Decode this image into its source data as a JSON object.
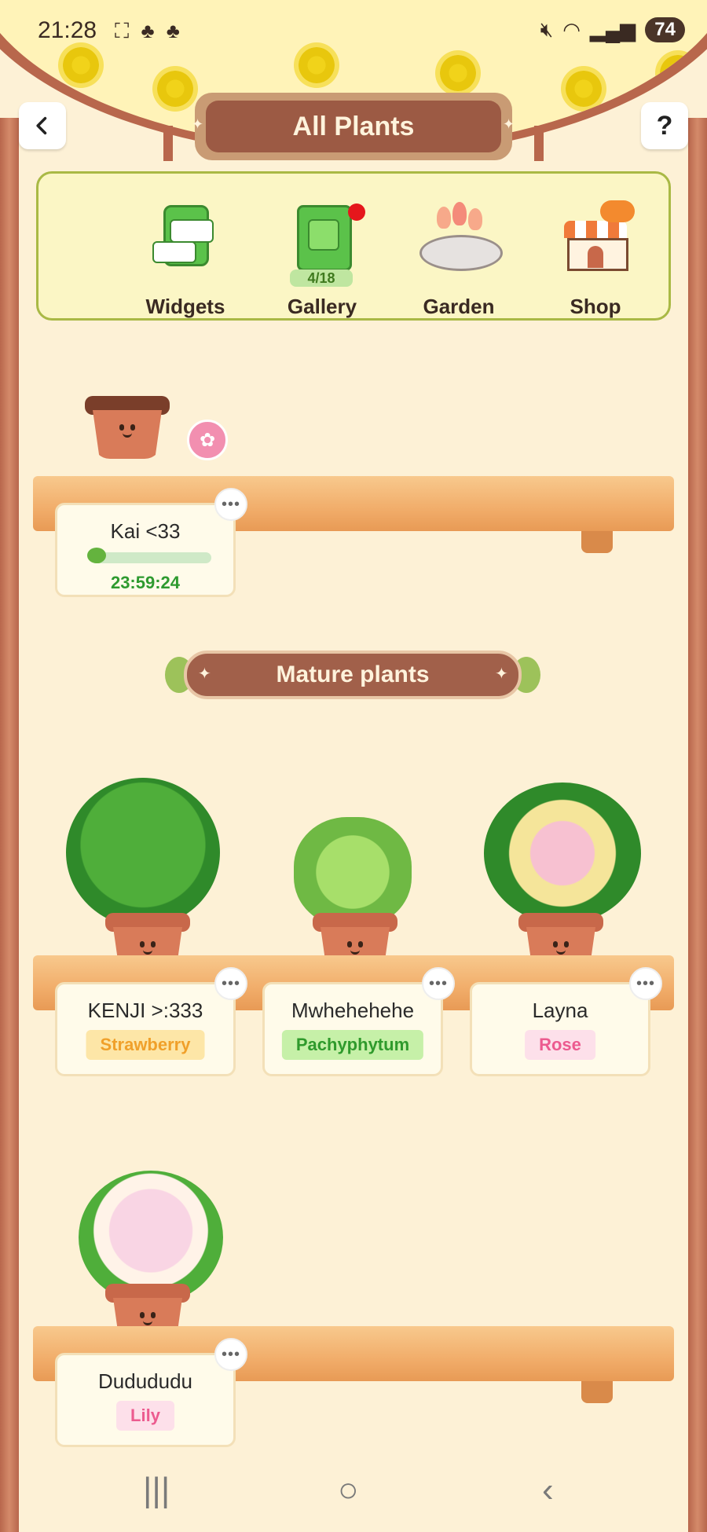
{
  "status_bar": {
    "time": "21:28",
    "battery": "74",
    "left_icons": [
      "screenshot-icon",
      "tree-icon",
      "tree-icon"
    ],
    "right_icons": [
      "mute-icon",
      "wifi-icon",
      "signal-icon"
    ]
  },
  "header": {
    "title": "All Plants",
    "help_label": "?"
  },
  "nav": {
    "items": [
      {
        "label": "Widgets",
        "icon": "widgets-icon"
      },
      {
        "label": "Gallery",
        "icon": "gallery-book-icon",
        "count": "4/18",
        "has_notification": true
      },
      {
        "label": "Garden",
        "icon": "garden-icon"
      },
      {
        "label": "Shop",
        "icon": "shop-icon"
      }
    ]
  },
  "growing": {
    "plants": [
      {
        "name": "Kai <33",
        "timer": "23:59:24",
        "progress_fraction": 0.08
      }
    ]
  },
  "mature": {
    "heading": "Mature plants",
    "plants": [
      {
        "name": "KENJI >:333",
        "species": "Strawberry",
        "tag_bg": "#fde6a7",
        "tag_fg": "#f0a02a"
      },
      {
        "name": "Mwhehehehe",
        "species": "Pachyphytum",
        "tag_bg": "#c6f0a8",
        "tag_fg": "#2f9a2c"
      },
      {
        "name": "Layna",
        "species": "Rose",
        "tag_bg": "#fde0ea",
        "tag_fg": "#ec5b8f"
      },
      {
        "name": "Dudududu",
        "species": "Lily",
        "tag_bg": "#fde0ea",
        "tag_fg": "#ec5b8f"
      }
    ]
  },
  "colors": {
    "frame": "#b8674c",
    "banner": "#a1604a",
    "background": "#fdf1d6"
  },
  "system_nav": {
    "recents": "|||",
    "home": "○",
    "back": "‹"
  }
}
